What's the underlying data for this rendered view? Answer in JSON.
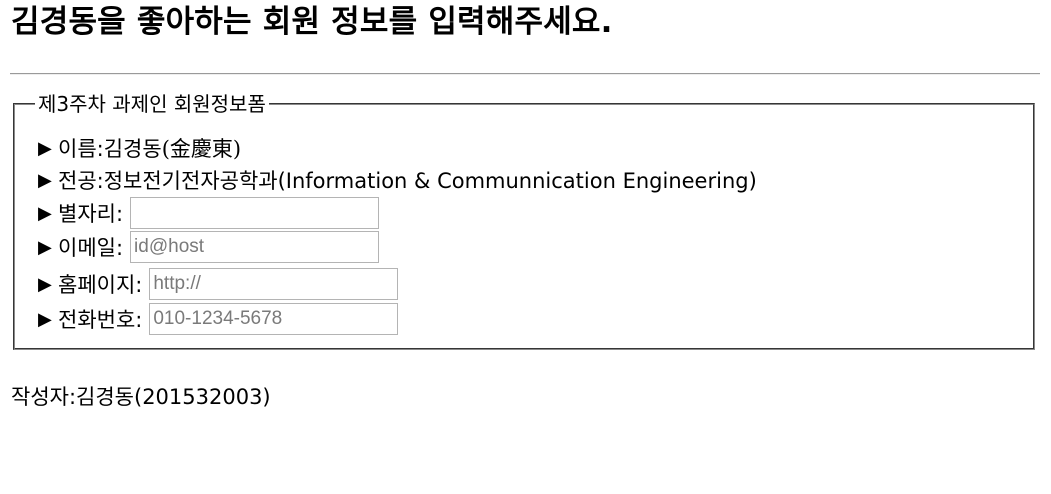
{
  "page": {
    "title": "김경동을 좋아하는 회원 정보를 입력해주세요."
  },
  "form": {
    "legend": "제3주차 과제인 회원정보폼",
    "arrow": "▶",
    "name": {
      "label": "이름:",
      "value": "김경동",
      "hanja": "(金慶東)"
    },
    "major": {
      "label": "전공:",
      "value": "정보전기전자공학과(Information & Communnication Engineering)"
    },
    "constellation": {
      "label": "별자리:",
      "value": "",
      "placeholder": ""
    },
    "email": {
      "label": "이메일:",
      "value": "",
      "placeholder": "id@host"
    },
    "homepage": {
      "label": "홈페이지:",
      "value": "",
      "placeholder": "http://"
    },
    "phone": {
      "label": "전화번호:",
      "value": "",
      "placeholder": "010-1234-5678"
    }
  },
  "footer": {
    "author": "작성자:김경동(201532003)"
  }
}
